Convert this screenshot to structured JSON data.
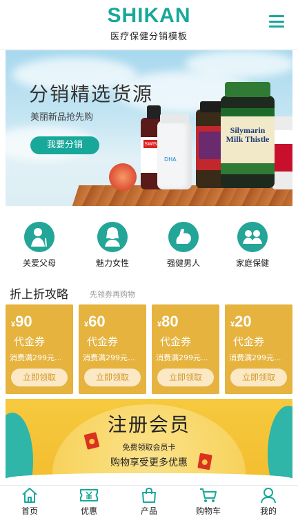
{
  "header": {
    "logo": "SHIKAN",
    "subtitle": "医疗保健分销模板",
    "menu_icon": "menu-icon"
  },
  "banner": {
    "title": "分销精选货源",
    "subtitle": "美丽新品抢先购",
    "button": "我要分销",
    "product_labels": {
      "swisse": "SWISSE",
      "dha": "DHA",
      "silymarin": "Silymarin Milk Thistle"
    }
  },
  "categories": [
    {
      "label": "关爱父母",
      "icon": "parents-icon"
    },
    {
      "label": "魅力女性",
      "icon": "woman-icon"
    },
    {
      "label": "强健男人",
      "icon": "muscle-icon"
    },
    {
      "label": "家庭保健",
      "icon": "family-icon"
    }
  ],
  "promo_section": {
    "title": "折上折攻略",
    "subtitle": "先领券再购物"
  },
  "coupons": [
    {
      "currency": "¥",
      "amount": "90",
      "name": "代金券",
      "condition": "消费满299元...",
      "button": "立即领取"
    },
    {
      "currency": "¥",
      "amount": "60",
      "name": "代金券",
      "condition": "消费满299元...",
      "button": "立即领取"
    },
    {
      "currency": "¥",
      "amount": "80",
      "name": "代金券",
      "condition": "消费满299元...",
      "button": "立即领取"
    },
    {
      "currency": "¥",
      "amount": "20",
      "name": "代金券",
      "condition": "消费满299元...",
      "button": "立即领取"
    }
  ],
  "register": {
    "title": "注册会员",
    "line1": "免费领取会员卡",
    "line2": "购物享受更多优惠"
  },
  "tabbar": [
    {
      "label": "首页",
      "icon": "home-icon"
    },
    {
      "label": "优惠",
      "icon": "coupon-icon"
    },
    {
      "label": "产品",
      "icon": "bag-icon"
    },
    {
      "label": "购物车",
      "icon": "cart-icon"
    },
    {
      "label": "我的",
      "icon": "user-icon"
    }
  ],
  "colors": {
    "brand": "#17a89a",
    "coupon": "#e5b33e",
    "register_bg": "#f3bd2f"
  }
}
